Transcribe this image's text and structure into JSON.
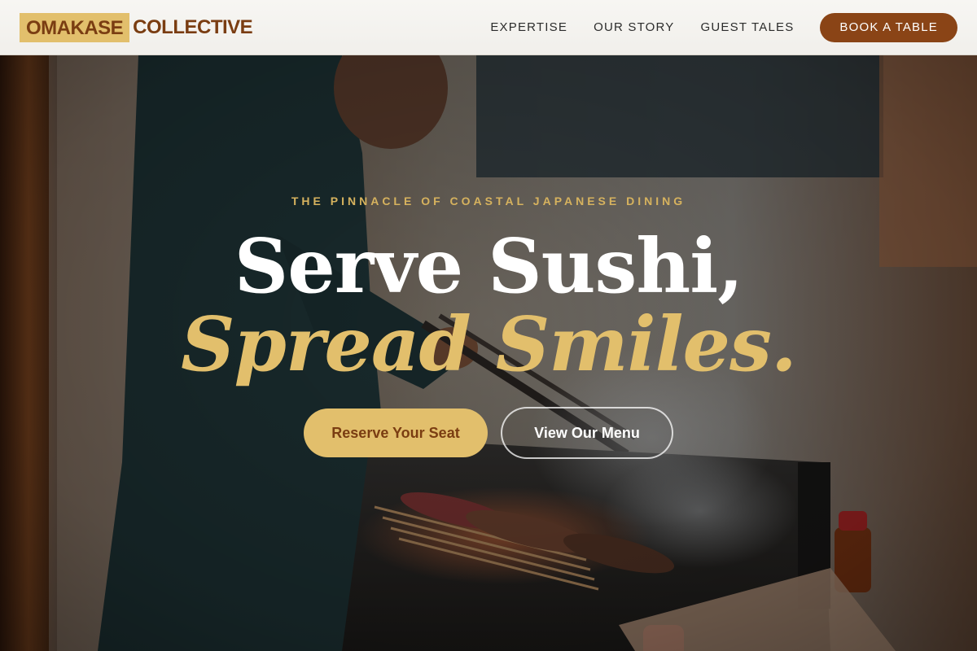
{
  "brand": {
    "name_part1": "OMAKASE",
    "name_part2": "COLLECTIVE"
  },
  "nav": {
    "links": [
      {
        "label": "EXPERTISE"
      },
      {
        "label": "OUR STORY"
      },
      {
        "label": "GUEST TALES"
      }
    ],
    "cta_label": "BOOK A TABLE"
  },
  "hero": {
    "eyebrow": "THE PINNACLE OF COASTAL JAPANESE DINING",
    "headline_line1": "Serve Sushi,",
    "headline_line2": "Spread Smiles.",
    "primary_cta": "Reserve Your Seat",
    "secondary_cta": "View Our Menu"
  },
  "colors": {
    "accent_gold": "#e2bf6c",
    "accent_brown": "#8a4416",
    "logo_text": "#7a3d12",
    "header_bg": "#f4f2ee"
  }
}
